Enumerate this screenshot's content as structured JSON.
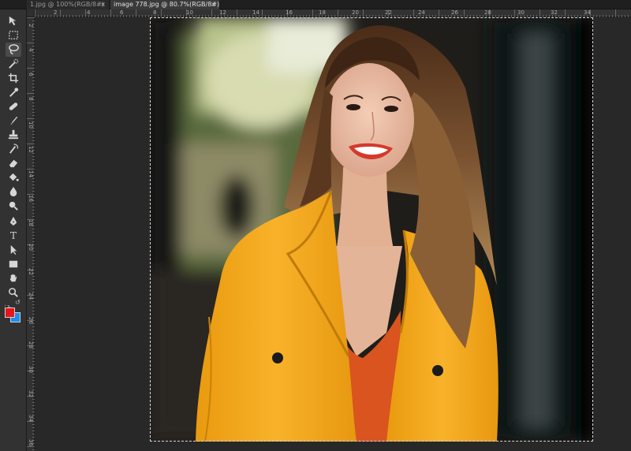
{
  "tabs": [
    {
      "label": "1.jpg @ 100%(RGB/8#)",
      "close": "×",
      "active": false
    },
    {
      "label": "image 778.jpg @ 80.7%(RGB/8#)",
      "close": "×",
      "active": true
    }
  ],
  "ruler_top_labels": [
    "2",
    "4",
    "6",
    "8",
    "10",
    "12",
    "14",
    "16",
    "18",
    "20",
    "22",
    "24",
    "26",
    "28",
    "30",
    "32",
    "34"
  ],
  "ruler_left_labels": [
    "2",
    "4",
    "6",
    "8",
    "10",
    "12",
    "14",
    "16",
    "18",
    "20",
    "22",
    "24",
    "26",
    "28",
    "30",
    "32",
    "34",
    "36"
  ],
  "tools": [
    {
      "name": "move-tool",
      "icon": "move-icon"
    },
    {
      "name": "marquee-tool",
      "icon": "marquee-icon"
    },
    {
      "name": "lasso-tool",
      "icon": "lasso-icon",
      "active": true
    },
    {
      "name": "quick-selection-tool",
      "icon": "quick-selection-icon"
    },
    {
      "name": "crop-tool",
      "icon": "crop-icon"
    },
    {
      "name": "eyedropper-tool",
      "icon": "eyedropper-icon"
    },
    {
      "name": "healing-brush-tool",
      "icon": "bandage-icon"
    },
    {
      "name": "brush-tool",
      "icon": "brush-icon"
    },
    {
      "name": "stamp-tool",
      "icon": "stamp-icon"
    },
    {
      "name": "history-brush-tool",
      "icon": "history-brush-icon"
    },
    {
      "name": "eraser-tool",
      "icon": "eraser-icon"
    },
    {
      "name": "paint-bucket-tool",
      "icon": "paint-bucket-icon"
    },
    {
      "name": "blur-tool",
      "icon": "drop-icon"
    },
    {
      "name": "dodge-tool",
      "icon": "dodge-icon"
    },
    {
      "name": "pen-tool",
      "icon": "pen-icon"
    },
    {
      "name": "type-tool",
      "icon": "type-icon",
      "label": "T"
    },
    {
      "name": "path-selection-tool",
      "icon": "arrow-icon"
    },
    {
      "name": "rectangle-tool",
      "icon": "rectangle-icon"
    },
    {
      "name": "hand-tool",
      "icon": "hand-icon"
    },
    {
      "name": "zoom-tool",
      "icon": "magnifier-icon"
    }
  ],
  "colors": {
    "foreground": "#e8141c",
    "background": "#1a8ff0"
  },
  "swap_glyph": "↺"
}
